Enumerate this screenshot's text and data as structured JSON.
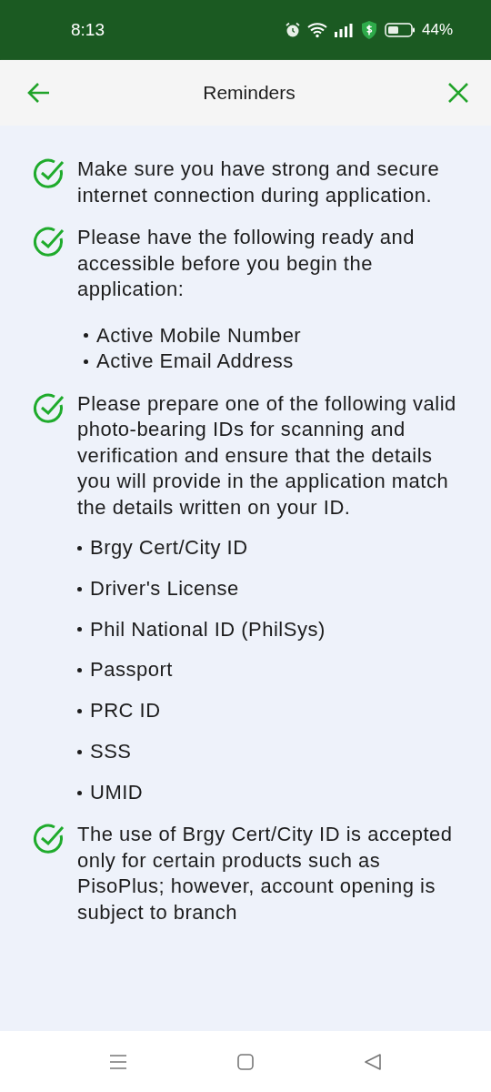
{
  "status_bar": {
    "time": "8:13",
    "battery": "44%"
  },
  "header": {
    "title": "Reminders"
  },
  "reminders": [
    {
      "text": "Make sure you have strong and secure internet connection during application."
    },
    {
      "text": "Please have the following ready and accessible before you begin the application:",
      "kind": "compact",
      "bullets": [
        "Active Mobile Number",
        "Active Email Address"
      ]
    },
    {
      "text": "Please prepare one of the following valid photo-bearing IDs for scanning and verification and ensure that the details you will provide in the application match the details written on your ID.",
      "kind": "spaced",
      "bullets": [
        "Brgy Cert/City ID",
        "Driver's License",
        "Phil National ID (PhilSys)",
        "Passport",
        "PRC ID",
        "SSS",
        "UMID"
      ]
    },
    {
      "text": "The use of Brgy Cert/City ID is accepted only for certain products such as PisoPlus; however, account opening is subject to branch"
    }
  ]
}
